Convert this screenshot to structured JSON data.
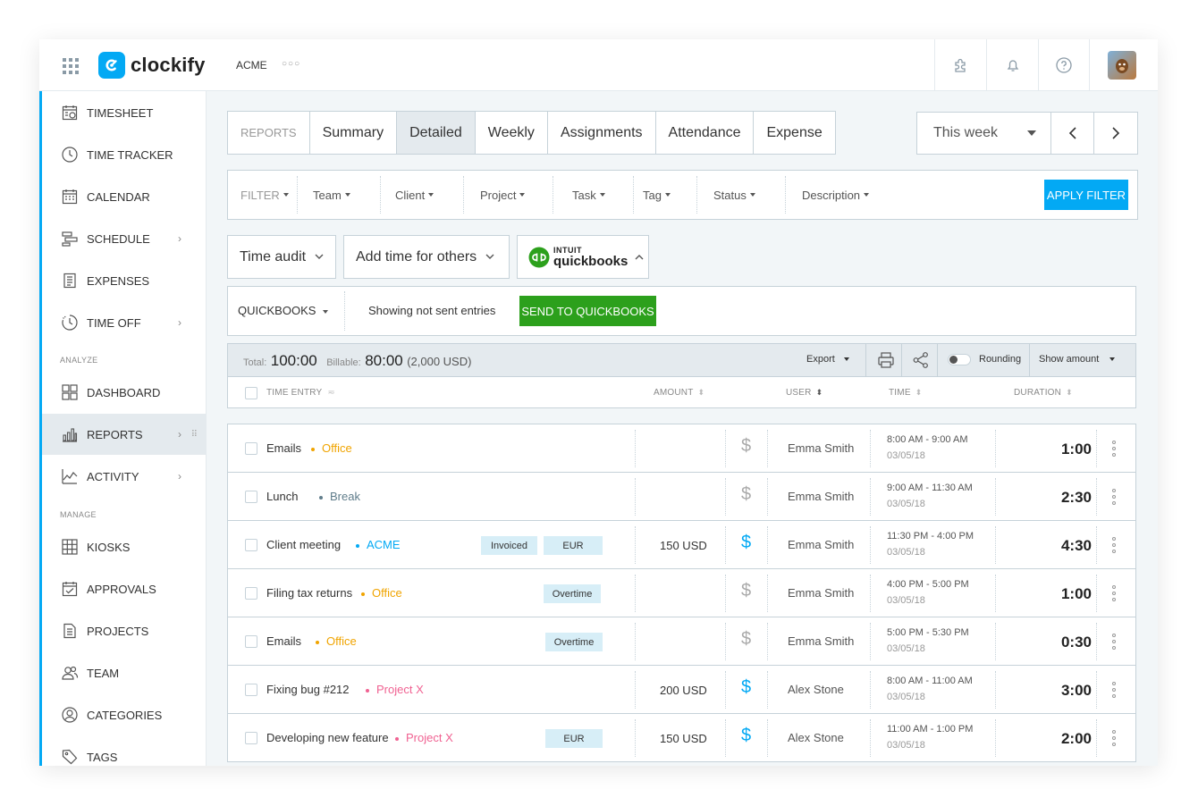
{
  "app": {
    "brand": "clockify",
    "workspace": "ACME",
    "accent": "#03a9f4"
  },
  "header": {
    "icons": [
      "apps-grid-icon",
      "extension-icon",
      "bell-icon",
      "help-icon",
      "avatar"
    ]
  },
  "sidebar": {
    "items": [
      {
        "label": "TIMESHEET",
        "icon": "timesheet-icon"
      },
      {
        "label": "TIME TRACKER",
        "icon": "clock-icon"
      },
      {
        "label": "CALENDAR",
        "icon": "calendar-icon"
      },
      {
        "label": "SCHEDULE",
        "icon": "schedule-icon"
      },
      {
        "label": "EXPENSES",
        "icon": "receipt-icon"
      },
      {
        "label": "TIME OFF",
        "icon": "time-off-icon"
      },
      {
        "label": "DASHBOARD",
        "icon": "dashboard-icon"
      },
      {
        "label": "REPORTS",
        "icon": "reports-icon"
      },
      {
        "label": "ACTIVITY",
        "icon": "activity-icon"
      },
      {
        "label": "KIOSKS",
        "icon": "kiosk-icon"
      },
      {
        "label": "APPROVALS",
        "icon": "approvals-icon"
      },
      {
        "label": "PROJECTS",
        "icon": "projects-icon"
      },
      {
        "label": "TEAM",
        "icon": "team-icon"
      },
      {
        "label": "CATEGORIES",
        "icon": "categories-icon"
      },
      {
        "label": "TAGS",
        "icon": "tag-icon"
      }
    ],
    "sections": {
      "analyze": "ANALYZE",
      "manage": "MANAGE"
    }
  },
  "tabs": {
    "label": "REPORTS",
    "items": [
      "Summary",
      "Detailed",
      "Weekly",
      "Assignments",
      "Attendance",
      "Expense"
    ],
    "active": "Detailed"
  },
  "daterange": {
    "value": "This week"
  },
  "filters": {
    "label": "FILTER",
    "items": [
      "Team",
      "Client",
      "Project",
      "Task",
      "Tag",
      "Status",
      "Description"
    ],
    "apply": "APPLY FILTER"
  },
  "dropdowns": {
    "time_audit": "Time audit",
    "add_time": "Add time for others",
    "qb_brand_top": "INTUIT",
    "qb_brand": "quickbooks"
  },
  "qb": {
    "select": "QUICKBOOKS",
    "status": "Showing not sent entries",
    "send": "SEND TO QUICKBOOKS",
    "color": "#2ca01c"
  },
  "summary": {
    "total_label": "Total:",
    "total": "100:00",
    "billable_label": "Billable:",
    "billable": "80:00",
    "billable_amount": "(2,000 USD)",
    "export": "Export",
    "rounding": "Rounding",
    "show_amount": "Show amount"
  },
  "columns": {
    "entry": "TIME ENTRY",
    "amount": "AMOUNT",
    "user": "USER",
    "time": "TIME",
    "duration": "DURATION"
  },
  "entries": [
    {
      "desc": "Emails",
      "project": "Office",
      "color": "#f0a400",
      "tags": [],
      "amount": "",
      "billable": false,
      "user": "Emma Smith",
      "time": "8:00 AM - 9:00 AM",
      "date": "03/05/18",
      "duration": "1:00"
    },
    {
      "desc": "Lunch",
      "project": "Break",
      "color": "#607d8b",
      "tags": [],
      "amount": "",
      "billable": false,
      "user": "Emma Smith",
      "time": "9:00 AM - 11:30 AM",
      "date": "03/05/18",
      "duration": "2:30"
    },
    {
      "desc": "Client meeting",
      "project": "ACME",
      "color": "#03a9f4",
      "tags": [
        "Invoiced",
        "EUR"
      ],
      "amount": "150 USD",
      "billable": true,
      "user": "Emma Smith",
      "time": "11:30 PM - 4:00 PM",
      "date": "03/05/18",
      "duration": "4:30"
    },
    {
      "desc": "Filing tax returns",
      "project": "Office",
      "color": "#f0a400",
      "tags": [
        "Overtime"
      ],
      "amount": "",
      "billable": false,
      "user": "Emma Smith",
      "time": "4:00 PM - 5:00 PM",
      "date": "03/05/18",
      "duration": "1:00"
    },
    {
      "desc": "Emails",
      "project": "Office",
      "color": "#f0a400",
      "tags": [
        "Overtime"
      ],
      "amount": "",
      "billable": false,
      "user": "Emma Smith",
      "time": "5:00 PM - 5:30 PM",
      "date": "03/05/18",
      "duration": "0:30"
    },
    {
      "desc": "Fixing bug #212",
      "project": "Project X",
      "color": "#f06292",
      "tags": [],
      "amount": "200 USD",
      "billable": true,
      "user": "Alex Stone",
      "time": "8:00 AM - 11:00 AM",
      "date": "03/05/18",
      "duration": "3:00"
    },
    {
      "desc": "Developing new feature",
      "project": "Project X",
      "color": "#f06292",
      "tags": [
        "EUR"
      ],
      "amount": "150 USD",
      "billable": true,
      "user": "Alex Stone",
      "time": "11:00 AM - 1:00 PM",
      "date": "03/05/18",
      "duration": "2:00"
    }
  ]
}
